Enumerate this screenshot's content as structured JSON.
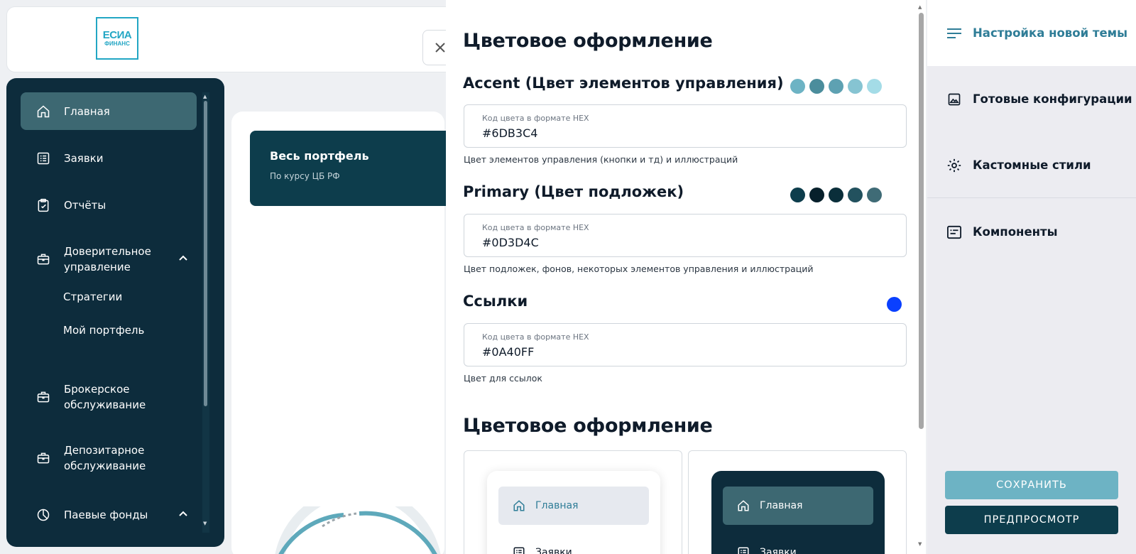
{
  "app": {
    "logo_line1": "ЕСИА",
    "logo_line2": "ФИНАНС",
    "close_symbol": "✕"
  },
  "sidebar": {
    "items": [
      {
        "label": "Главная",
        "icon": "home-icon",
        "active": true
      },
      {
        "label": "Заявки",
        "icon": "list-icon"
      },
      {
        "label": "Отчёты",
        "icon": "clipboard-check-icon"
      },
      {
        "label": "Доверительное управление",
        "icon": "briefcase-icon",
        "expanded": true
      },
      {
        "label": "Брокерское обслуживание",
        "icon": "briefcase-icon"
      },
      {
        "label": "Депозитарное обслуживание",
        "icon": "briefcase-icon"
      },
      {
        "label": "Паевые фонды",
        "icon": "pie-chart-icon",
        "expanded": true
      }
    ],
    "subitems": [
      "Стратегии",
      "Мой портфель"
    ]
  },
  "portfolio": {
    "title": "Весь портфель",
    "subtitle": "По курсу ЦБ РФ"
  },
  "settings": {
    "section_title": "Цветовое оформление",
    "field_label": "Код цвета в формате HEX",
    "accent": {
      "title": "Accent (Цвет элементов управления)",
      "value": "#6DB3C4",
      "hint": "Цвет элементов управления (кнопки и тд) и иллюстраций",
      "swatches": [
        "#6db3c4",
        "#4b8d9c",
        "#5ea1b2",
        "#86c4d2",
        "#a4dce7"
      ]
    },
    "primary": {
      "title": "Primary (Цвет подложек)",
      "value": "#0D3D4C",
      "hint": "Цвет подложек, фонов, некоторых элементов управления и иллюстраций",
      "swatches": [
        "#0d3d4c",
        "#07202b",
        "#0a2e3a",
        "#22515e",
        "#3f6b76"
      ]
    },
    "links": {
      "title": "Ссылки",
      "value": "#0A40FF",
      "hint": "Цвет для ссылок",
      "swatches": [
        "#0a40ff"
      ]
    },
    "section_title_2": "Цветовое оформление",
    "preview_light": {
      "item1": "Главная",
      "item2": "Заявки"
    },
    "preview_dark": {
      "item1": "Главная",
      "item2": "Заявки"
    }
  },
  "right_menu": {
    "items": [
      {
        "label": "Настройка новой темы",
        "icon": "menu-lines-icon",
        "active": true
      },
      {
        "label": "Готовые конфигурации",
        "icon": "image-icon"
      },
      {
        "label": "Кастомные стили",
        "icon": "gear-icon"
      },
      {
        "label": "Компоненты",
        "icon": "component-card-icon"
      }
    ],
    "save_label": "СОХРАНИТЬ",
    "preview_label": "ПРЕДПРОСМОТР"
  },
  "colors": {
    "accent": "#6db3c4",
    "primary": "#0d3d4c",
    "sidebar_bg": "#0d2c3c",
    "link": "#0a40ff"
  }
}
